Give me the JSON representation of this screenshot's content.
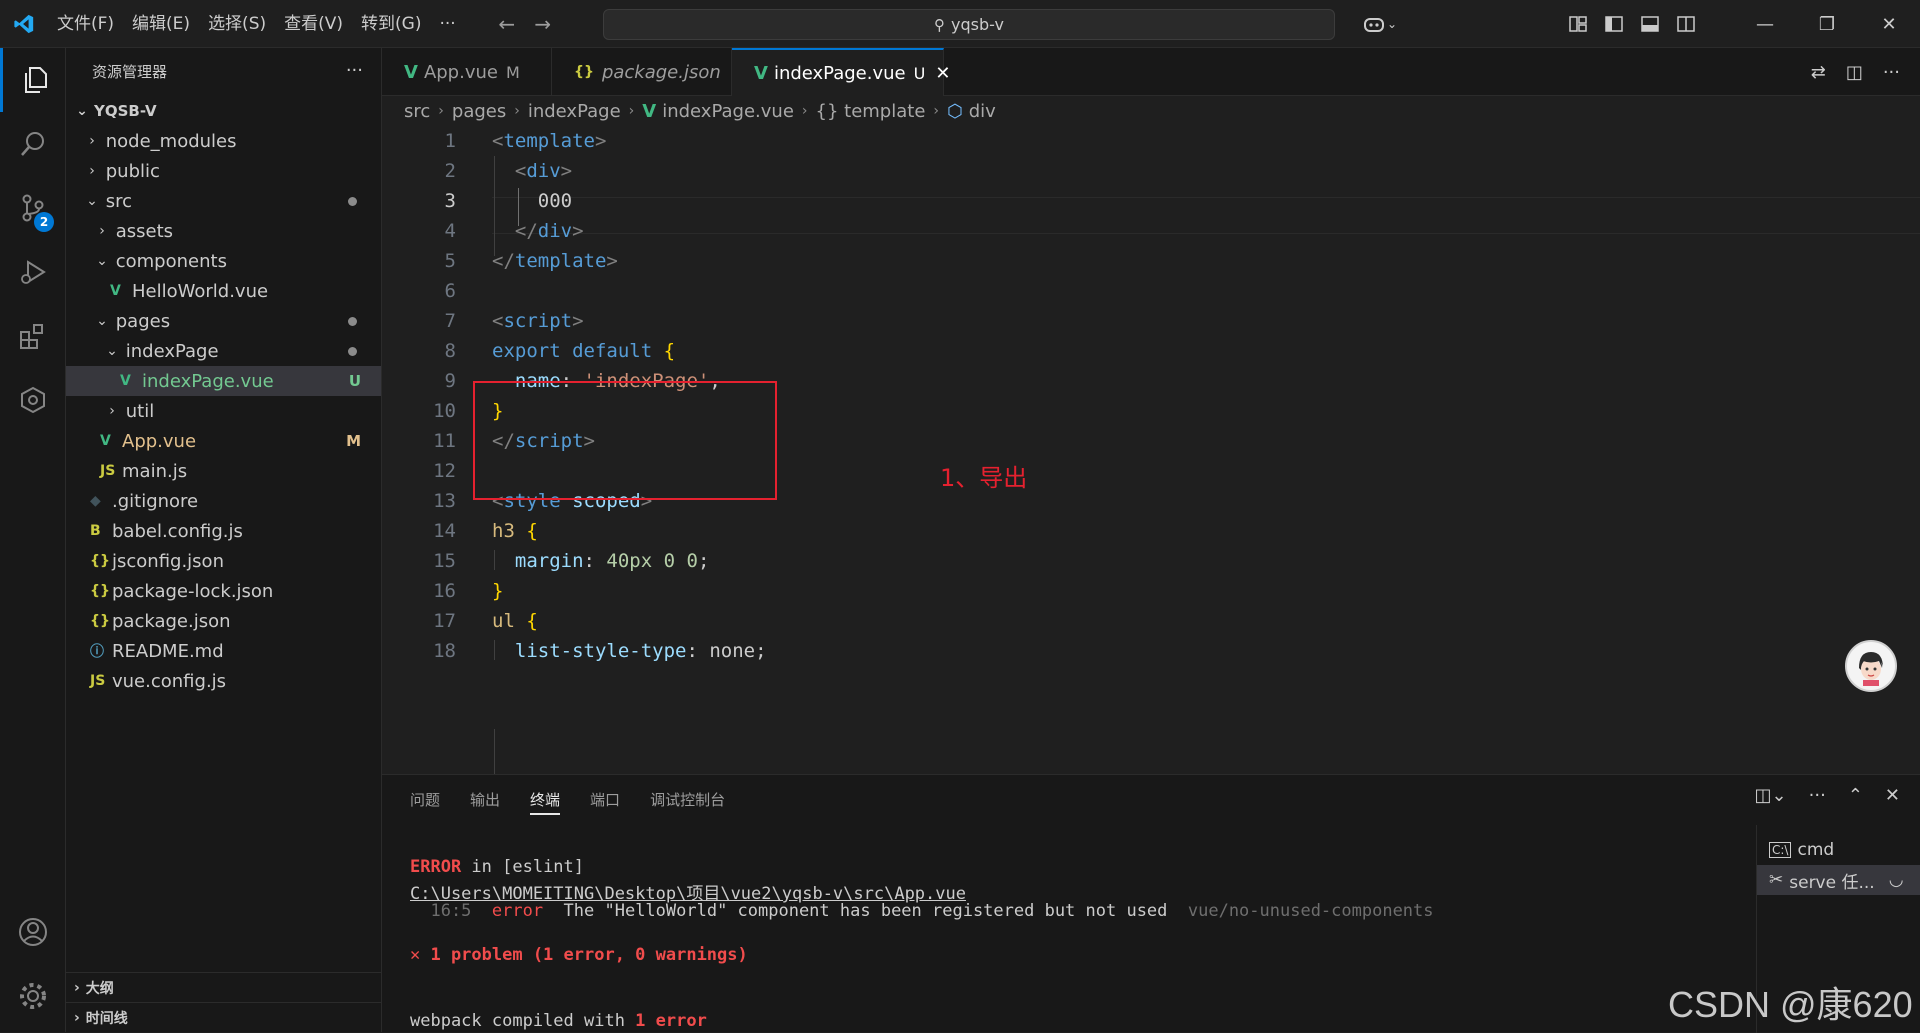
{
  "titlebar": {
    "menus": [
      "文件(F)",
      "编辑(E)",
      "选择(S)",
      "查看(V)",
      "转到(G)"
    ],
    "more": "···",
    "search": "yqsb-v"
  },
  "activity": {
    "scm_badge": "2"
  },
  "explorer": {
    "title": "资源管理器",
    "more": "···",
    "root": "YQSB-V",
    "items": [
      {
        "label": "node_modules",
        "chev": "›",
        "icon": ""
      },
      {
        "label": "public",
        "chev": "›",
        "icon": ""
      },
      {
        "label": "src",
        "chev": "⌄",
        "icon": ""
      },
      {
        "label": "assets",
        "chev": "›",
        "icon": ""
      },
      {
        "label": "components",
        "chev": "⌄",
        "icon": ""
      },
      {
        "label": "HelloWorld.vue",
        "chev": "",
        "icon": "V"
      },
      {
        "label": "pages",
        "chev": "⌄",
        "icon": ""
      },
      {
        "label": "indexPage",
        "chev": "⌄",
        "icon": ""
      },
      {
        "label": "indexPage.vue",
        "chev": "",
        "icon": "V",
        "status": "U"
      },
      {
        "label": "util",
        "chev": "›",
        "icon": ""
      },
      {
        "label": "App.vue",
        "chev": "",
        "icon": "V",
        "status": "M"
      },
      {
        "label": "main.js",
        "chev": "",
        "icon": "JS"
      },
      {
        "label": ".gitignore",
        "chev": "",
        "icon": "◆"
      },
      {
        "label": "babel.config.js",
        "chev": "",
        "icon": "B"
      },
      {
        "label": "jsconfig.json",
        "chev": "",
        "icon": "{}"
      },
      {
        "label": "package-lock.json",
        "chev": "",
        "icon": "{}"
      },
      {
        "label": "package.json",
        "chev": "",
        "icon": "{}"
      },
      {
        "label": "README.md",
        "chev": "",
        "icon": "ⓘ"
      },
      {
        "label": "vue.config.js",
        "chev": "",
        "icon": "JS"
      }
    ],
    "outline": "大纲",
    "timeline": "时间线"
  },
  "tabs": [
    {
      "label": "App.vue",
      "mod": "M"
    },
    {
      "label": "package.json",
      "mod": ""
    },
    {
      "label": "indexPage.vue",
      "mod": "U",
      "close": "✕"
    }
  ],
  "breadcrumb": [
    "src",
    "pages",
    "indexPage",
    "indexPage.vue",
    "{} template",
    "div"
  ],
  "editor": {
    "line_numbers": [
      "1",
      "2",
      "3",
      "4",
      "5",
      "6",
      "7",
      "8",
      "9",
      "10",
      "11",
      "12",
      "13",
      "14",
      "15",
      "16",
      "17",
      "18"
    ],
    "annotation": "1、导出"
  },
  "panel": {
    "tabs": [
      "问题",
      "输出",
      "终端",
      "端口",
      "调试控制台"
    ],
    "terminal": {
      "l1_error": "ERROR",
      "l1_rest": " in [eslint]",
      "l2": "C:\\Users\\MOMEITING\\Desktop\\项目\\vue2\\yqsb-v\\src\\App.vue",
      "l3_pos": "  16:5",
      "l3_error": "  error",
      "l3_msg": "  The \"HelloWorld\" component has been registered but not used",
      "l3_rule": "  vue/no-unused-components",
      "l4": "✕ 1 problem (1 error, 0 warnings)",
      "l5_a": "webpack compiled with ",
      "l5_b": "1 error"
    },
    "terminals": [
      "cmd",
      "serve 任..."
    ]
  },
  "watermark": "CSDN @康620"
}
